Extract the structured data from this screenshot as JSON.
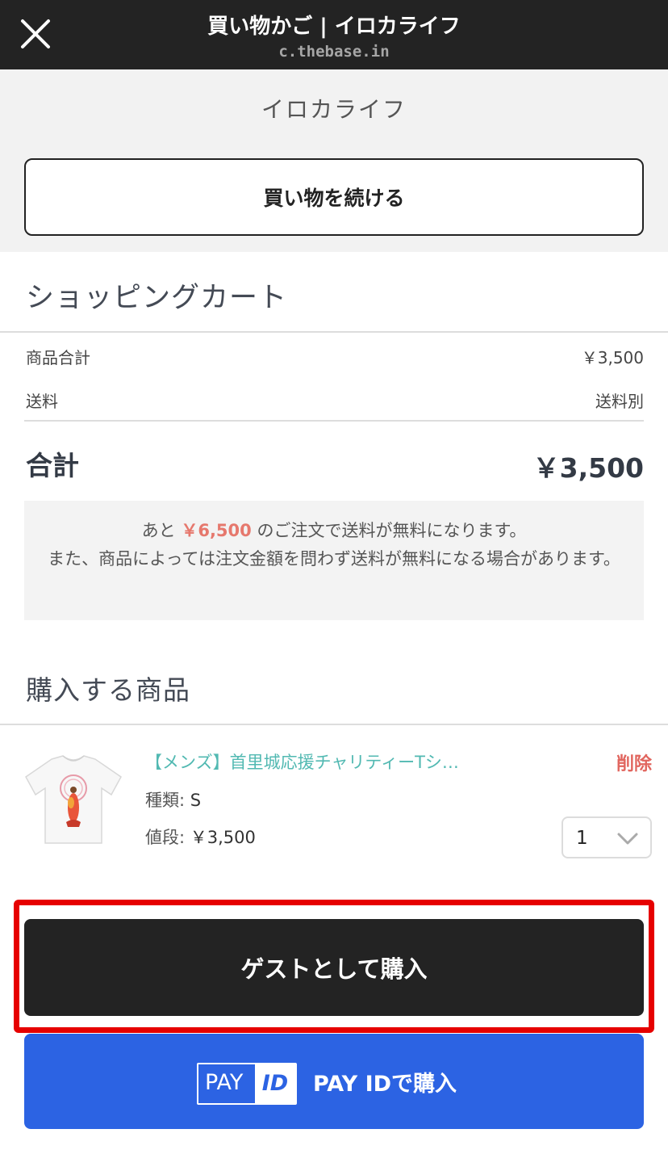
{
  "header": {
    "title": "買い物かご | イロカライフ",
    "url": "c.thebase.in",
    "close_icon": "close-icon"
  },
  "shop": {
    "name": "イロカライフ",
    "continue_label": "買い物を続ける"
  },
  "cart": {
    "title": "ショッピングカート",
    "subtotal_label": "商品合計",
    "subtotal_value": "￥3,500",
    "shipping_label": "送料",
    "shipping_value": "送料別",
    "total_label": "合計",
    "total_value": "￥3,500"
  },
  "notice": {
    "prefix": "あと",
    "amount": "￥6,500",
    "suffix": "のご注文で送料が無料になります。",
    "line2": "また、商品によっては注文金額を問わず送料が無料になる場合があります。",
    "amount_color": "#e6786d"
  },
  "items_section": {
    "title": "購入する商品",
    "items": [
      {
        "name": "【メンズ】首里城応援チャリティーTシ…",
        "delete_label": "削除",
        "type_label": "種類:",
        "type_value": "S",
        "price_label": "値段:",
        "price_value": "￥3,500",
        "quantity": "1",
        "thumbnail_icon": "tshirt-thumbnail"
      }
    ]
  },
  "actions": {
    "guest_label": "ゲストとして購入",
    "payid_label": "PAY IDで購入",
    "payid_logo_pay": "PAY",
    "payid_logo_id": "ID",
    "highlight_color": "#e60000",
    "payid_color": "#2c63e3"
  }
}
